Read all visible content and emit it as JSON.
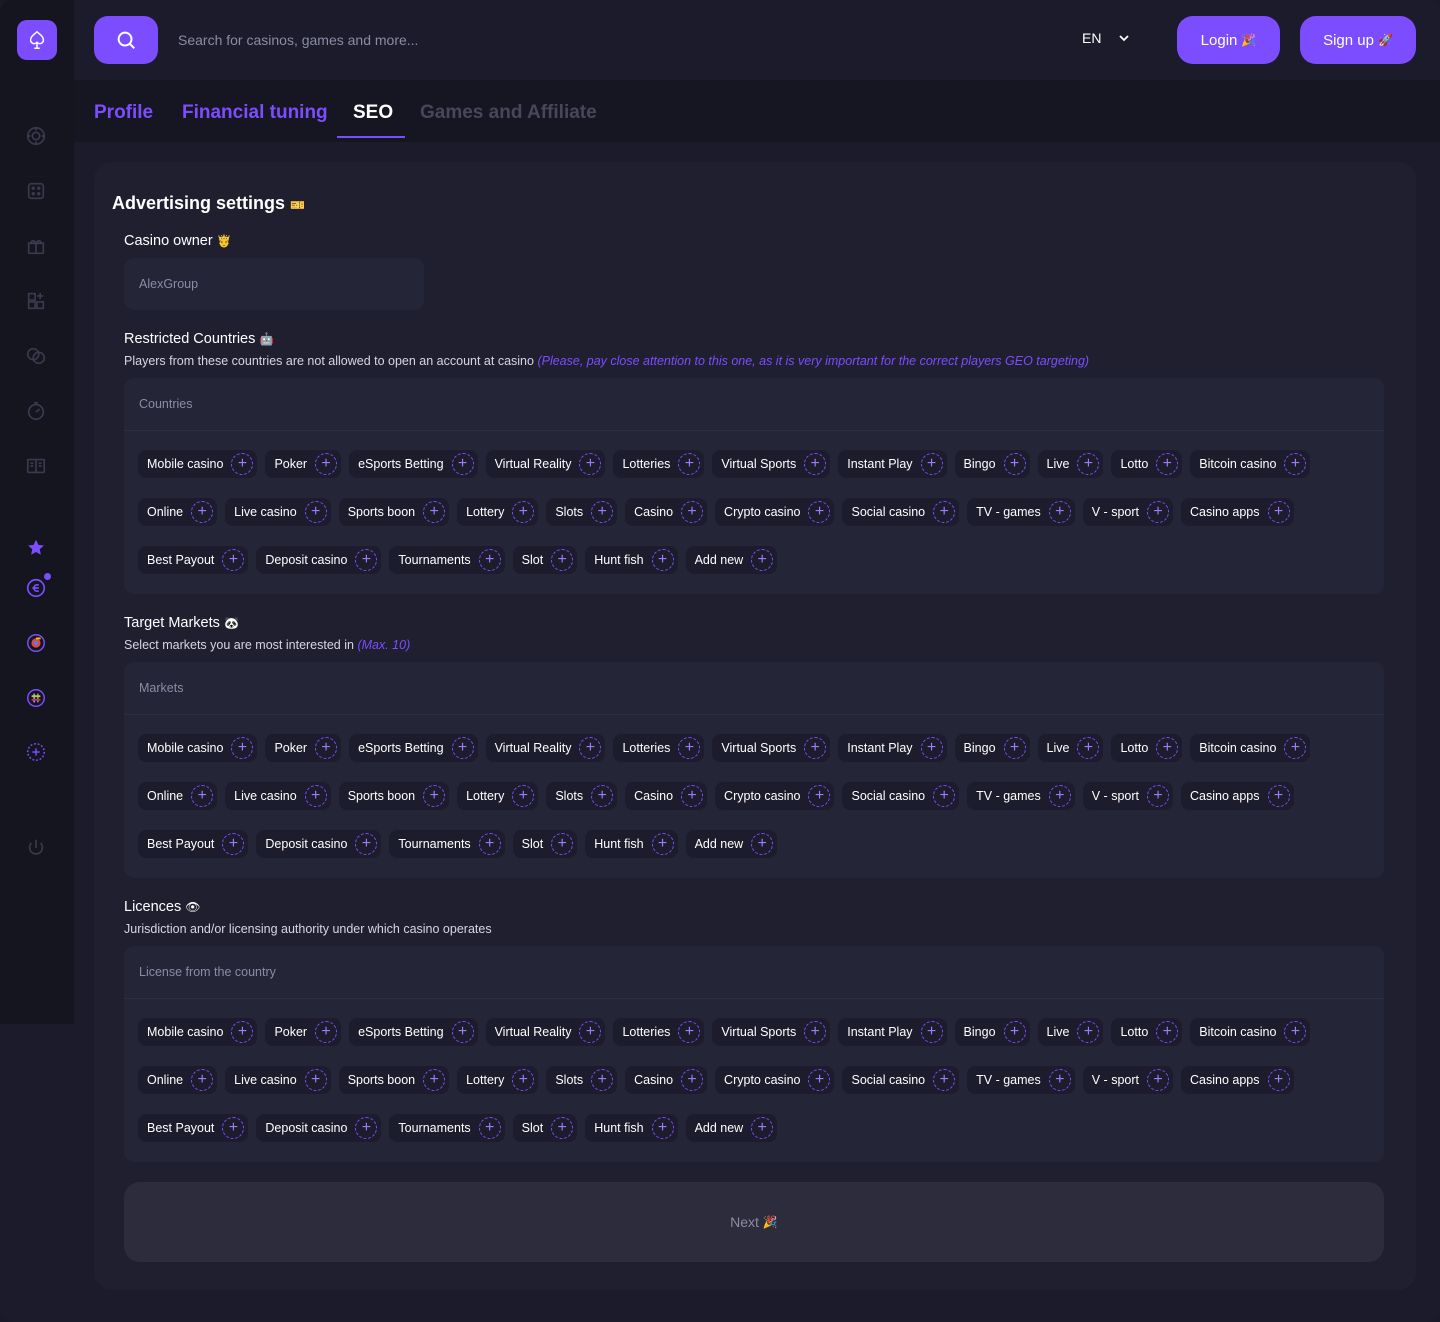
{
  "header": {
    "search_placeholder": "Search for casinos, games and more...",
    "language": "EN",
    "login_label": "Login",
    "login_emoji": "🎉",
    "signup_label": "Sign up",
    "signup_emoji": "🚀"
  },
  "tabs": [
    {
      "label": "Profile",
      "state": "done"
    },
    {
      "label": "Financial tuning",
      "state": "done"
    },
    {
      "label": "SEO",
      "state": "active"
    },
    {
      "label": "Games and Affiliate",
      "state": "disabled"
    }
  ],
  "sidebar": {
    "icons": [
      "casino-chip-icon",
      "dice-icon",
      "gift-icon",
      "add-grid-icon",
      "coins-icon",
      "timer-icon",
      "book-icon",
      "star-icon",
      "brand-icon",
      "chrome-icon",
      "slack-icon",
      "add-circle-icon",
      "power-icon"
    ]
  },
  "card": {
    "title": "Advertising settings",
    "title_emoji": "🎫",
    "owner": {
      "label": "Casino owner",
      "emoji": "🤴",
      "value": "AlexGroup"
    },
    "restricted": {
      "label": "Restricted Countries",
      "emoji": "🤖",
      "description": "Players from these countries are not allowed to open an account at casino",
      "note": "(Please, pay close attention to this one, as it is very important for the correct players GEO targeting)",
      "box_title": "Countries"
    },
    "markets": {
      "label": "Target Markets",
      "emoji": "🐼",
      "description": "Select markets you are most interested in",
      "note": "(Max. 10)",
      "box_title": "Markets"
    },
    "licences": {
      "label": "Licences",
      "emoji": "👁",
      "description": "Jurisdiction and/or licensing authority under which casino operates",
      "box_title": "License from the country"
    },
    "tag_rows": [
      [
        "Mobile casino",
        "Poker",
        "eSports Betting",
        "Virtual Reality",
        "Lotteries",
        "Virtual Sports",
        "Instant Play",
        "Bingo",
        "Live",
        "Lotto",
        "Bitcoin casino"
      ],
      [
        "Online",
        "Live casino",
        "Sports boon",
        "Lottery",
        "Slots",
        "Casino",
        "Crypto casino",
        "Social casino",
        "TV - games",
        "V - sport",
        "Casino apps"
      ],
      [
        "Best Payout",
        "Deposit casino",
        "Tournaments",
        "Slot",
        "Hunt fish",
        "Add new"
      ]
    ],
    "next_label": "Next",
    "next_emoji": "🎉"
  },
  "colors": {
    "accent": "#7c4dff",
    "background": "#1b1b2c",
    "card": "#1f1f30",
    "field": "#252538"
  }
}
